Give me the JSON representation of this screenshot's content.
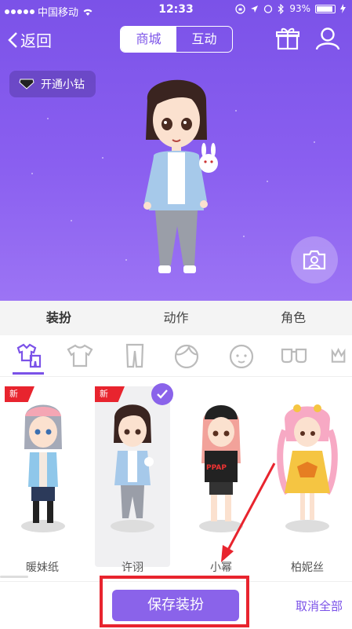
{
  "status_bar": {
    "carrier": "中国移动",
    "time": "12:33",
    "battery": "93%"
  },
  "header": {
    "back_label": "返回",
    "tabs": [
      {
        "label": "商城",
        "active": true
      },
      {
        "label": "互动",
        "active": false
      }
    ]
  },
  "vip_button": {
    "label": "开通小钻"
  },
  "main_tabs": [
    {
      "label": "装扮",
      "active": true
    },
    {
      "label": "动作",
      "active": false
    },
    {
      "label": "角色",
      "active": false
    }
  ],
  "categories": [
    "outfit-set-icon",
    "top-icon",
    "pants-icon",
    "hair-icon",
    "face-icon",
    "glasses-icon",
    "accessory-icon"
  ],
  "items": [
    {
      "name": "暖妹纸",
      "badge": "新",
      "selected": false
    },
    {
      "name": "许诩",
      "badge": "新",
      "selected": true
    },
    {
      "name": "小幂",
      "badge": "",
      "selected": false
    },
    {
      "name": "柏妮丝",
      "badge": "",
      "selected": false
    }
  ],
  "footer": {
    "save_label": "保存装扮",
    "cancel_label": "取消全部"
  },
  "colors": {
    "accent": "#7b52e8",
    "highlight": "#e8242e"
  }
}
